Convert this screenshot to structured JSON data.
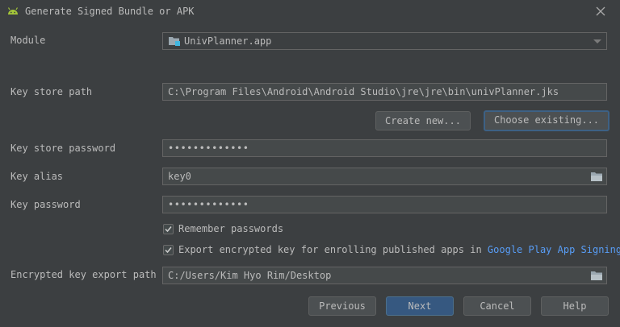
{
  "window": {
    "title": "Generate Signed Bundle or APK"
  },
  "form": {
    "module": {
      "label": "Module",
      "value": "UnivPlanner.app"
    },
    "key_store_path": {
      "label": "Key store path",
      "value": "C:\\Program Files\\Android\\Android Studio\\jre\\jre\\bin\\univPlanner.jks"
    },
    "create_new_label": "Create new...",
    "choose_existing_label": "Choose existing...",
    "key_store_password": {
      "label": "Key store password",
      "value": "•••••••••••••"
    },
    "key_alias": {
      "label": "Key alias",
      "value": "key0"
    },
    "key_password": {
      "label": "Key password",
      "value": "•••••••••••••"
    },
    "remember_passwords": {
      "label": "Remember passwords",
      "checked": true
    },
    "export_encrypted": {
      "label": "Export encrypted key for enrolling published apps in",
      "link": "Google Play App Signing",
      "checked": true
    },
    "encrypted_key_export_path": {
      "label": "Encrypted key export path",
      "value": "C:/Users/Kim Hyo Rim/Desktop"
    }
  },
  "buttons": {
    "previous": "Previous",
    "next": "Next",
    "cancel": "Cancel",
    "help": "Help"
  },
  "icons": {
    "title_icon": "android-icon",
    "close": "close-icon",
    "module_icon": "module-folder-icon",
    "folder": "folder-icon",
    "checkbox": "checkmark-icon"
  },
  "colors": {
    "background": "#3c3f41",
    "field_bg": "#45494a",
    "text": "#bbbbbb",
    "link": "#589df6",
    "primary_button": "#365880",
    "android_green": "#a4c639"
  }
}
